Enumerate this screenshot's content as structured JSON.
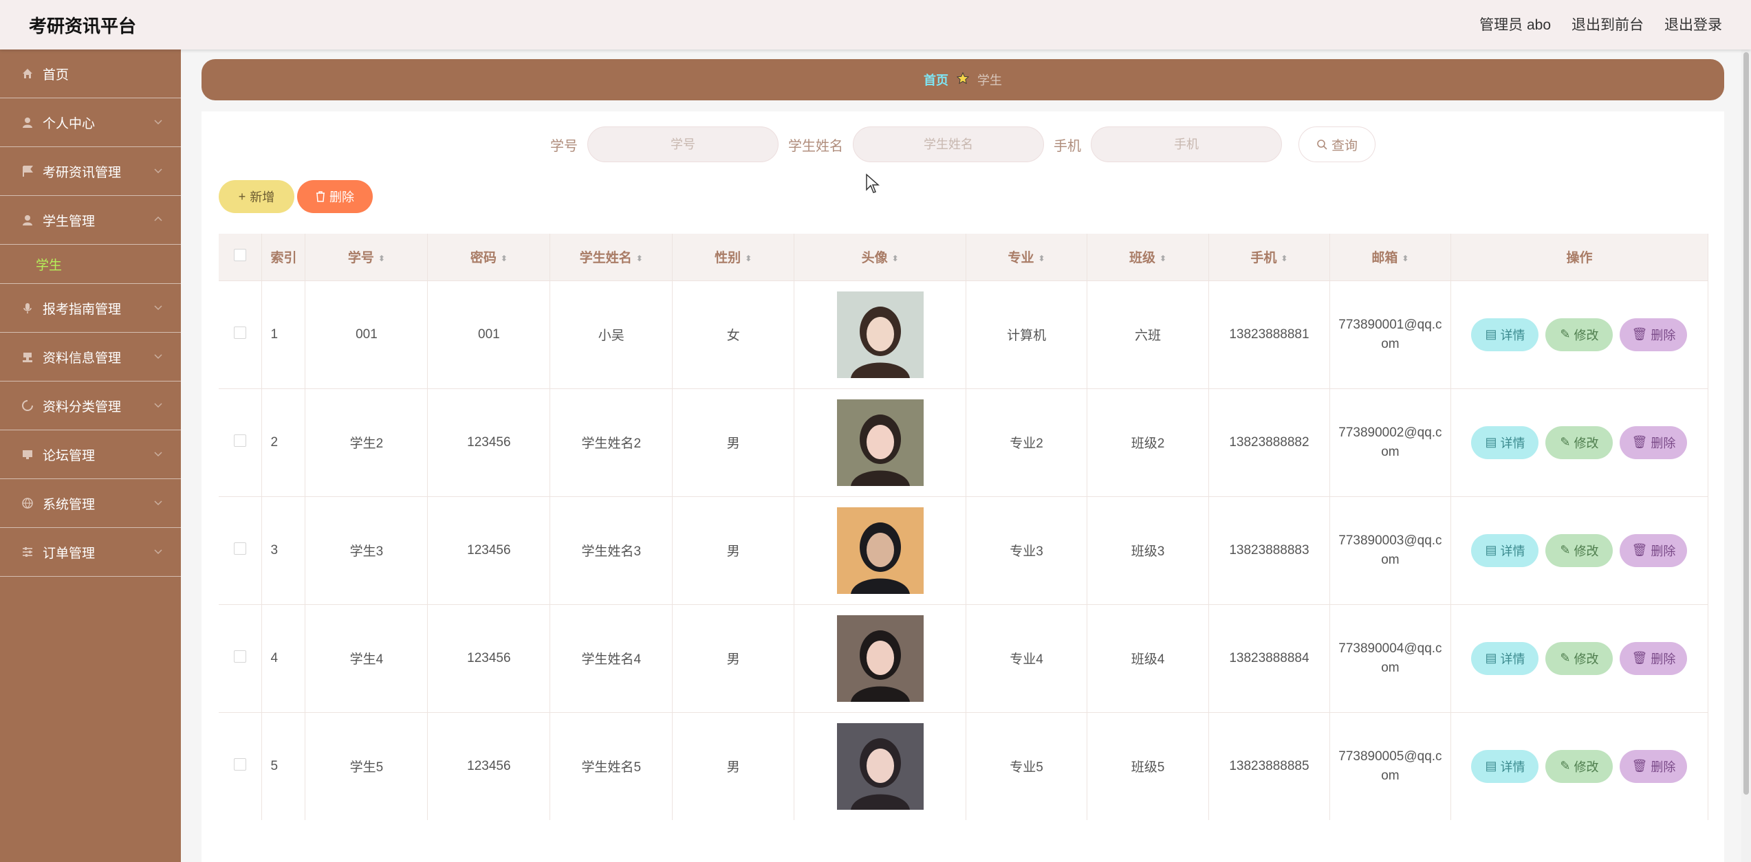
{
  "header": {
    "title": "考研资讯平台",
    "user": "管理员 abo",
    "front_link": "退出到前台",
    "logout": "退出登录"
  },
  "sidebar": {
    "items": [
      {
        "label": "首页",
        "icon": "home-icon"
      },
      {
        "label": "个人中心",
        "icon": "user-icon"
      },
      {
        "label": "考研资讯管理",
        "icon": "flag-icon"
      },
      {
        "label": "学生管理",
        "icon": "user-icon"
      },
      {
        "label": "报考指南管理",
        "icon": "mic-icon"
      },
      {
        "label": "资料信息管理",
        "icon": "stamp-icon"
      },
      {
        "label": "资料分类管理",
        "icon": "spinner-icon"
      },
      {
        "label": "论坛管理",
        "icon": "monitor-icon"
      },
      {
        "label": "系统管理",
        "icon": "globe-icon"
      },
      {
        "label": "订单管理",
        "icon": "sliders-icon"
      }
    ],
    "sub_item": "学生"
  },
  "breadcrumb": {
    "home": "首页",
    "current": "学生"
  },
  "search": {
    "fields": [
      {
        "label": "学号",
        "placeholder": "学号"
      },
      {
        "label": "学生姓名",
        "placeholder": "学生姓名"
      },
      {
        "label": "手机",
        "placeholder": "手机"
      }
    ],
    "button": "查询"
  },
  "actions": {
    "add": "新增",
    "delete": "删除"
  },
  "table": {
    "headers": [
      "索引",
      "学号",
      "密码",
      "学生姓名",
      "性别",
      "头像",
      "专业",
      "班级",
      "手机",
      "邮箱",
      "操作"
    ],
    "rows": [
      {
        "idx": "1",
        "sid": "001",
        "pwd": "001",
        "name": "小吴",
        "gender": "女",
        "major": "计算机",
        "cls": "六班",
        "phone": "13823888881",
        "email_a": "773890001@qq.c",
        "email_b": "om"
      },
      {
        "idx": "2",
        "sid": "学生2",
        "pwd": "123456",
        "name": "学生姓名2",
        "gender": "男",
        "major": "专业2",
        "cls": "班级2",
        "phone": "13823888882",
        "email_a": "773890002@qq.c",
        "email_b": "om"
      },
      {
        "idx": "3",
        "sid": "学生3",
        "pwd": "123456",
        "name": "学生姓名3",
        "gender": "男",
        "major": "专业3",
        "cls": "班级3",
        "phone": "13823888883",
        "email_a": "773890003@qq.c",
        "email_b": "om"
      },
      {
        "idx": "4",
        "sid": "学生4",
        "pwd": "123456",
        "name": "学生姓名4",
        "gender": "男",
        "major": "专业4",
        "cls": "班级4",
        "phone": "13823888884",
        "email_a": "773890004@qq.c",
        "email_b": "om"
      },
      {
        "idx": "5",
        "sid": "学生5",
        "pwd": "123456",
        "name": "学生姓名5",
        "gender": "男",
        "major": "专业5",
        "cls": "班级5",
        "phone": "13823888885",
        "email_a": "773890005@qq.c",
        "email_b": "om"
      }
    ],
    "ops": {
      "view": "详情",
      "edit": "修改",
      "delete": "删除"
    }
  }
}
